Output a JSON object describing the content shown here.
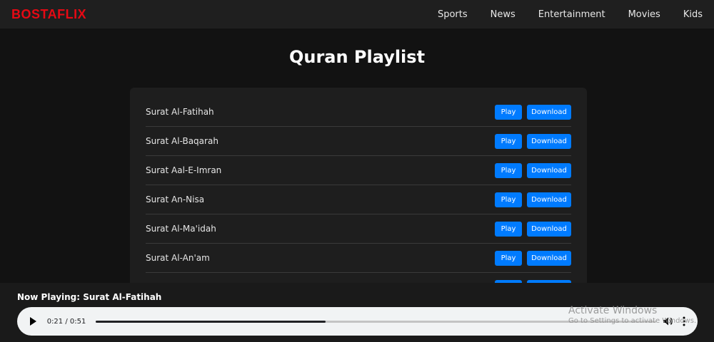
{
  "brand": {
    "logo": "BOSTAFLIX",
    "color": "#e50914"
  },
  "nav": {
    "links": [
      "Sports",
      "News",
      "Entertainment",
      "Movies",
      "Kids"
    ]
  },
  "page": {
    "title": "Quran Playlist"
  },
  "tracks": [
    {
      "name": "Surat Al-Fatihah",
      "play": "Play",
      "download": "Download"
    },
    {
      "name": "Surat Al-Baqarah",
      "play": "Play",
      "download": "Download"
    },
    {
      "name": "Surat Aal-E-Imran",
      "play": "Play",
      "download": "Download"
    },
    {
      "name": "Surat An-Nisa",
      "play": "Play",
      "download": "Download"
    },
    {
      "name": "Surat Al-Ma'idah",
      "play": "Play",
      "download": "Download"
    },
    {
      "name": "Surat Al-An'am",
      "play": "Play",
      "download": "Download"
    },
    {
      "name": "",
      "play": "",
      "download": ""
    }
  ],
  "player": {
    "now_playing": "Now Playing: Surat Al-Fatihah",
    "time": "0:21 / 0:51",
    "progress": 0.41
  },
  "watermark": {
    "title": "Activate Windows",
    "subtitle": "Go to Settings to activate Windows."
  },
  "colors": {
    "accent": "#007bff",
    "background": "#121212",
    "card": "#1e1e1e"
  }
}
